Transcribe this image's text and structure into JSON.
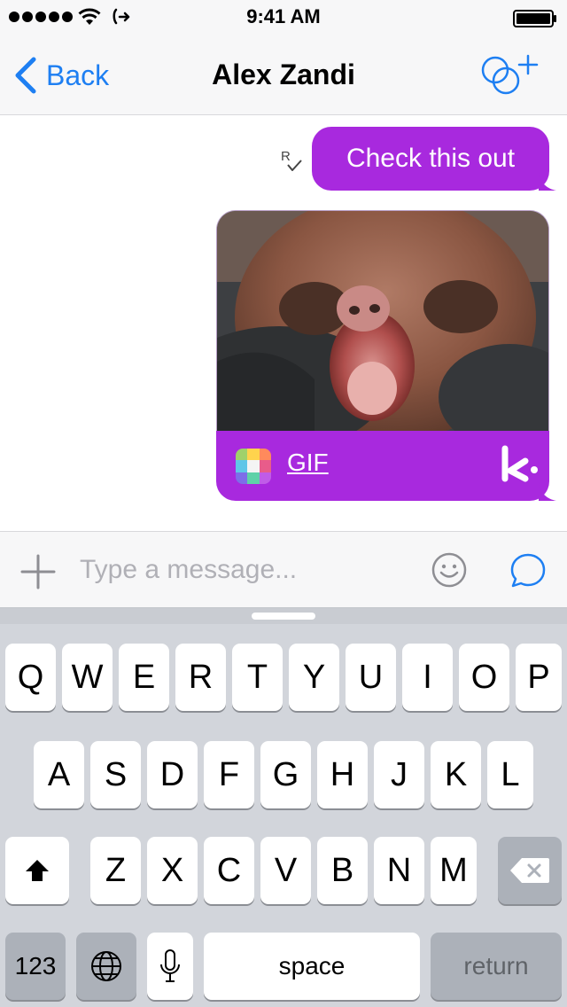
{
  "status_bar": {
    "time": "9:41 AM",
    "signal_dots": 5,
    "icons": [
      "wifi-icon",
      "call-forward-icon",
      "battery-icon"
    ]
  },
  "nav": {
    "back_label": "Back",
    "title": "Alex Zandi",
    "right_icon": "add-to-group-icon"
  },
  "colors": {
    "accent_blue": "#1e7ff2",
    "bubble_purple": "#a829de",
    "keyboard_bg": "#d2d5db"
  },
  "conversation": {
    "messages": [
      {
        "text": "Check this out",
        "receipt": "R"
      }
    ],
    "gif_card": {
      "link_label": "GIF",
      "app_icon": "gif-app-icon",
      "brand_icon": "kik-logo-icon"
    }
  },
  "input": {
    "placeholder": "Type a message...",
    "value": ""
  },
  "keyboard": {
    "row1": [
      "Q",
      "W",
      "E",
      "R",
      "T",
      "Y",
      "U",
      "I",
      "O",
      "P"
    ],
    "row2": [
      "A",
      "S",
      "D",
      "F",
      "G",
      "H",
      "J",
      "K",
      "L"
    ],
    "row3": [
      "Z",
      "X",
      "C",
      "V",
      "B",
      "N",
      "M"
    ],
    "numbers_label": "123",
    "space_label": "space",
    "return_label": "return"
  }
}
